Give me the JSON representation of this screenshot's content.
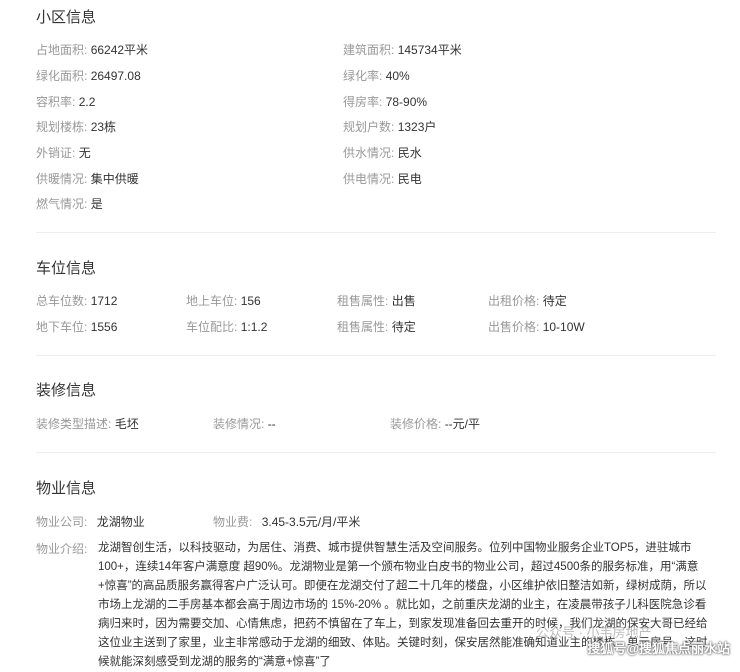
{
  "community": {
    "title": "小区信息",
    "items": [
      {
        "label": "占地面积:",
        "value": "66242平米"
      },
      {
        "label": "建筑面积:",
        "value": "145734平米"
      },
      {
        "label": "绿化面积:",
        "value": "26497.08"
      },
      {
        "label": "绿化率:",
        "value": "40%"
      },
      {
        "label": "容积率:",
        "value": "2.2"
      },
      {
        "label": "得房率:",
        "value": "78-90%"
      },
      {
        "label": "规划楼栋:",
        "value": "23栋"
      },
      {
        "label": "规划户数:",
        "value": "1323户"
      },
      {
        "label": "外销证:",
        "value": "无"
      },
      {
        "label": "供水情况:",
        "value": "民水"
      },
      {
        "label": "供暖情况:",
        "value": "集中供暖"
      },
      {
        "label": "供电情况:",
        "value": "民电"
      },
      {
        "label": "燃气情况:",
        "value": "是"
      }
    ]
  },
  "parking": {
    "title": "车位信息",
    "items": [
      {
        "label": "总车位数:",
        "value": "1712"
      },
      {
        "label": "地上车位:",
        "value": "156"
      },
      {
        "label": "租售属性:",
        "value": "出售"
      },
      {
        "label": "出租价格:",
        "value": "待定"
      },
      {
        "label": "地下车位:",
        "value": "1556"
      },
      {
        "label": "车位配比:",
        "value": "1:1.2"
      },
      {
        "label": "租售属性:",
        "value": "待定"
      },
      {
        "label": "出售价格:",
        "value": "10-10W"
      }
    ]
  },
  "decoration": {
    "title": "装修信息",
    "items": [
      {
        "label": "装修类型描述:",
        "value": "毛坯"
      },
      {
        "label": "装修情况:",
        "value": "--"
      },
      {
        "label": "装修价格:",
        "value": "--元/平"
      }
    ]
  },
  "property": {
    "title": "物业信息",
    "company_label": "物业公司:",
    "company_value": "龙湖物业",
    "fee_label": "物业费:",
    "fee_value": "3.45-3.5元/月/平米",
    "desc_label": "物业介绍:",
    "desc_value": "龙湖智创生活，以科技驱动，为居住、消费、城市提供智慧生活及空间服务。位列中国物业服务企业TOP5，进驻城市100+，连续14年客户满意度 超90%。龙湖物业是第一个颁布物业白皮书的物业公司，超过4500条的服务标准，用“满意+惊喜”的高品质服务赢得客户广泛认可。即便在龙湖交付了超二十几年的楼盘，小区维护依旧整洁如新，绿树成荫，所以市场上龙湖的二手房基本都会高于周边市场的 15%-20% 。就比如，之前重庆龙湖的业主，在凌晨带孩子儿科医院急诊看病归来时，因为需要交加、心情焦虑，把药不慎留在了车上，到家发现准备回去重开的时候，我们龙湖的保安大哥已经给这位业主送到了家里，业主非常感动于龙湖的细致、体贴。关键时刻，保安居然能准确知道业主的楼栋、单元房号，这时候就能深刻感受到龙湖的服务的“满意+惊喜”了"
  },
  "watermark": {
    "faint": "公众号 · 小韦房地产",
    "main": "搜狐号@搜狐焦点丽水站"
  }
}
